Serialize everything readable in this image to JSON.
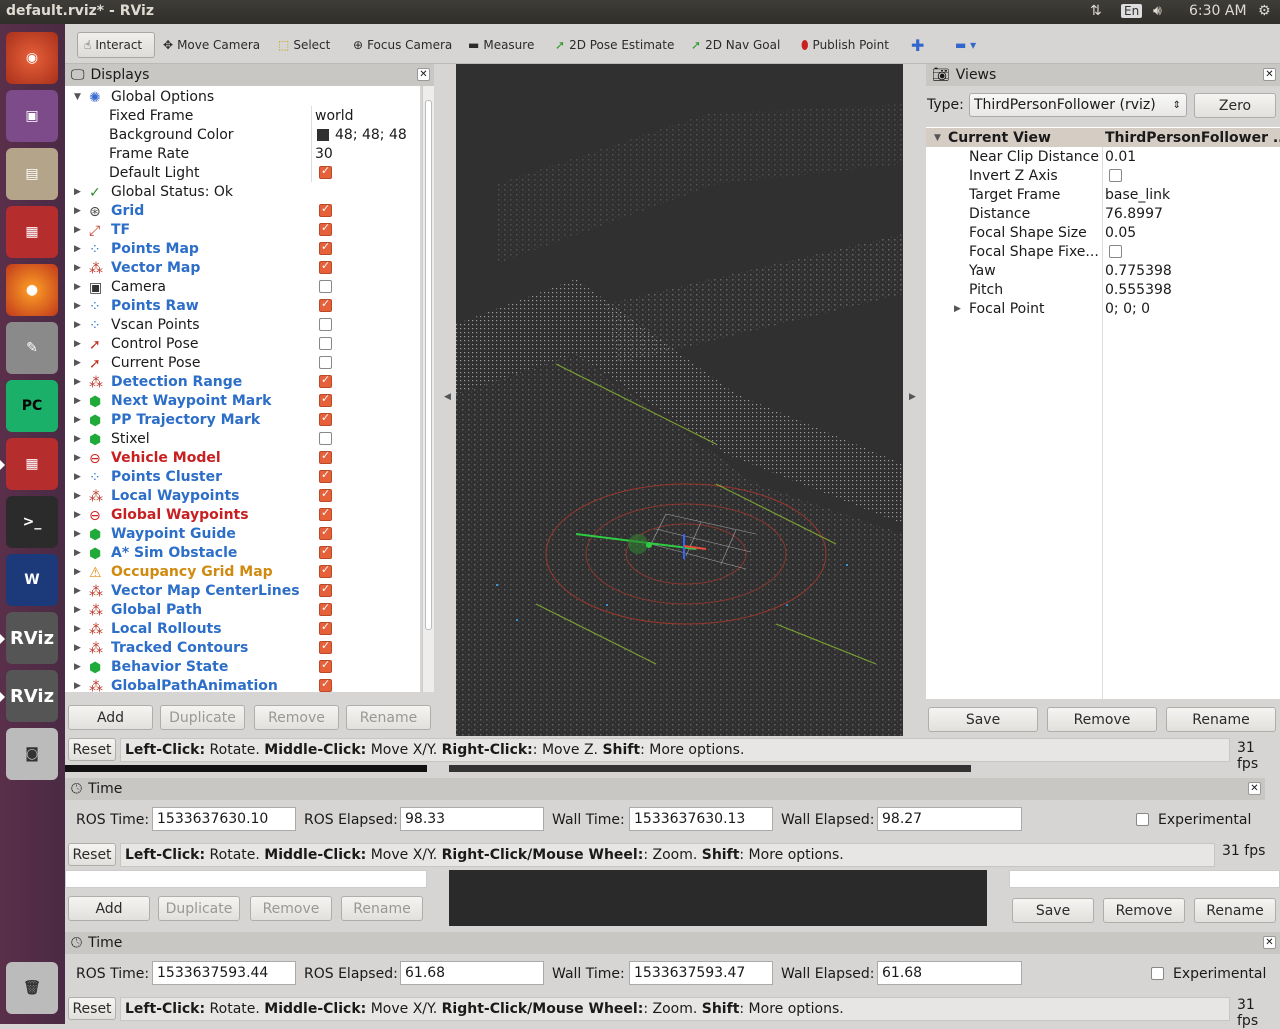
{
  "window_title": "default.rviz* - RViz",
  "topbar": {
    "keyboard": "En",
    "clock": "6:30 AM"
  },
  "toolbar": {
    "interact": "Interact",
    "move_camera": "Move Camera",
    "select": "Select",
    "focus_camera": "Focus Camera",
    "measure": "Measure",
    "pose_estimate": "2D Pose Estimate",
    "nav_goal": "2D Nav Goal",
    "publish_point": "Publish Point"
  },
  "displays": {
    "title": "Displays",
    "global_options": "Global Options",
    "props": [
      {
        "name": "Fixed Frame",
        "value": "world"
      },
      {
        "name": "Background Color",
        "value": "48; 48; 48"
      },
      {
        "name": "Frame Rate",
        "value": "30"
      },
      {
        "name": "Default Light",
        "value": ""
      }
    ],
    "global_status": "Global Status: Ok",
    "items": [
      {
        "name": "Grid",
        "style": "blue",
        "checked": true,
        "icon": "grid-icon"
      },
      {
        "name": "TF",
        "style": "blue",
        "checked": true,
        "icon": "tf-icon"
      },
      {
        "name": "Points Map",
        "style": "blue",
        "checked": true,
        "icon": "points-icon"
      },
      {
        "name": "Vector Map",
        "style": "blue",
        "checked": true,
        "icon": "marker-icon"
      },
      {
        "name": "Camera",
        "style": "plain",
        "checked": false,
        "icon": "camera-icon"
      },
      {
        "name": "Points Raw",
        "style": "blue",
        "checked": true,
        "icon": "points-icon"
      },
      {
        "name": "Vscan Points",
        "style": "plain",
        "checked": false,
        "icon": "points-icon"
      },
      {
        "name": "Control Pose",
        "style": "plain",
        "checked": false,
        "icon": "pose-icon"
      },
      {
        "name": "Current Pose",
        "style": "plain",
        "checked": false,
        "icon": "pose-icon"
      },
      {
        "name": "Detection Range",
        "style": "blue",
        "checked": true,
        "icon": "marker-icon"
      },
      {
        "name": "Next Waypoint Mark",
        "style": "blue",
        "checked": true,
        "icon": "cube-icon"
      },
      {
        "name": "PP Trajectory Mark",
        "style": "blue",
        "checked": true,
        "icon": "cube-icon"
      },
      {
        "name": "Stixel",
        "style": "plain",
        "checked": false,
        "icon": "cube-icon"
      },
      {
        "name": "Vehicle Model",
        "style": "red",
        "checked": true,
        "icon": "error-icon"
      },
      {
        "name": "Points Cluster",
        "style": "blue",
        "checked": true,
        "icon": "points-icon"
      },
      {
        "name": "Local Waypoints",
        "style": "blue",
        "checked": true,
        "icon": "marker-icon"
      },
      {
        "name": "Global Waypoints",
        "style": "red",
        "checked": true,
        "icon": "error-icon"
      },
      {
        "name": "Waypoint Guide",
        "style": "blue",
        "checked": true,
        "icon": "cube-icon"
      },
      {
        "name": "A* Sim Obstacle",
        "style": "blue",
        "checked": true,
        "icon": "cube-icon"
      },
      {
        "name": "Occupancy Grid Map",
        "style": "orange",
        "checked": true,
        "icon": "warning-icon"
      },
      {
        "name": "Vector Map CenterLines",
        "style": "blue",
        "checked": true,
        "icon": "marker-icon"
      },
      {
        "name": "Global Path",
        "style": "blue",
        "checked": true,
        "icon": "marker-icon"
      },
      {
        "name": "Local Rollouts",
        "style": "blue",
        "checked": true,
        "icon": "marker-icon"
      },
      {
        "name": "Tracked Contours",
        "style": "blue",
        "checked": true,
        "icon": "marker-icon"
      },
      {
        "name": "Behavior State",
        "style": "blue",
        "checked": true,
        "icon": "cube-icon"
      },
      {
        "name": "GlobalPathAnimation",
        "style": "blue",
        "checked": true,
        "icon": "marker-icon"
      }
    ],
    "buttons": {
      "add": "Add",
      "duplicate": "Duplicate",
      "remove": "Remove",
      "rename": "Rename"
    }
  },
  "views": {
    "title": "Views",
    "type_label": "Type:",
    "type_value": "ThirdPersonFollower (rviz)",
    "zero": "Zero",
    "current_view": "Current View",
    "current_view_value": "ThirdPersonFollower ...",
    "props": [
      {
        "name": "Near Clip Distance",
        "value": "0.01"
      },
      {
        "name": "Invert Z Axis",
        "value": ""
      },
      {
        "name": "Target Frame",
        "value": "base_link"
      },
      {
        "name": "Distance",
        "value": "76.8997"
      },
      {
        "name": "Focal Shape Size",
        "value": "0.05"
      },
      {
        "name": "Focal Shape Fixe...",
        "value": ""
      },
      {
        "name": "Yaw",
        "value": "0.775398"
      },
      {
        "name": "Pitch",
        "value": "0.555398"
      },
      {
        "name": "Focal Point",
        "value": "0; 0; 0"
      }
    ],
    "buttons": {
      "save": "Save",
      "remove": "Remove",
      "rename": "Rename"
    }
  },
  "status1": {
    "reset": "Reset",
    "fps": "31 fps"
  },
  "time1": {
    "title": "Time",
    "ros_time_label": "ROS Time:",
    "ros_time": "1533637630.10",
    "ros_elapsed_label": "ROS Elapsed:",
    "ros_elapsed": "98.33",
    "wall_time_label": "Wall Time:",
    "wall_time": "1533637630.13",
    "wall_elapsed_label": "Wall Elapsed:",
    "wall_elapsed": "98.27",
    "experimental": "Experimental"
  },
  "status2": {
    "reset": "Reset",
    "fps": "31 fps"
  },
  "ghost_buttons": {
    "add": "Add",
    "duplicate": "Duplicate",
    "remove": "Remove",
    "rename": "Rename",
    "save": "Save",
    "remove2": "Remove",
    "rename2": "Rename"
  },
  "time2": {
    "title": "Time",
    "ros_time_label": "ROS Time:",
    "ros_time": "1533637593.44",
    "ros_elapsed_label": "ROS Elapsed:",
    "ros_elapsed": "61.68",
    "wall_time_label": "Wall Time:",
    "wall_time": "1533637593.47",
    "wall_elapsed_label": "Wall Elapsed:",
    "wall_elapsed": "61.68",
    "experimental": "Experimental"
  },
  "status3": {
    "reset": "Reset",
    "fps": "31 fps"
  }
}
